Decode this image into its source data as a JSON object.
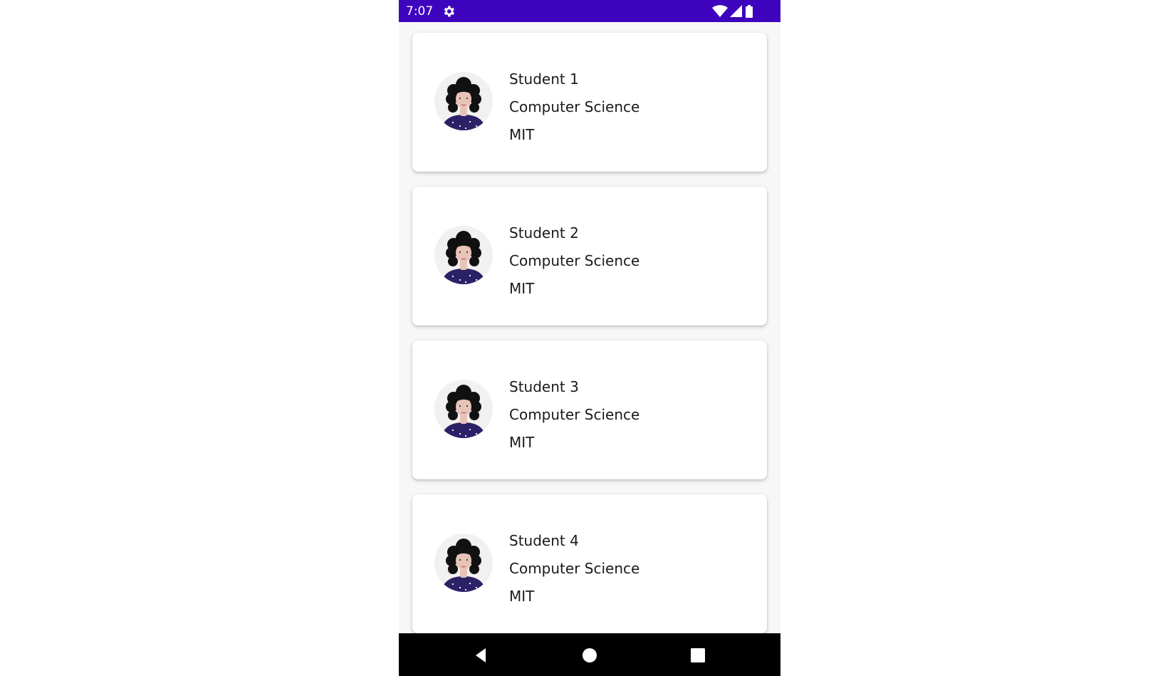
{
  "colors": {
    "accent": "#3e04bd",
    "nav_bar": "#000000",
    "card_background": "#ffffff",
    "avatar_shirt": "#2a2166",
    "avatar_hair": "#111111",
    "avatar_skin": "#e8c3b8"
  },
  "status_bar": {
    "time": "7:07",
    "icons": [
      "settings-icon",
      "wifi-icon",
      "cell-signal-icon",
      "battery-icon"
    ]
  },
  "students": [
    {
      "name": "Student 1",
      "major": "Computer Science",
      "school": "MIT",
      "avatar": "woman-avatar-icon"
    },
    {
      "name": "Student 2",
      "major": "Computer Science",
      "school": "MIT",
      "avatar": "woman-avatar-icon"
    },
    {
      "name": "Student 3",
      "major": "Computer Science",
      "school": "MIT",
      "avatar": "woman-avatar-icon"
    },
    {
      "name": "Student 4",
      "major": "Computer Science",
      "school": "MIT",
      "avatar": "woman-avatar-icon"
    }
  ],
  "nav_bar": {
    "icons": [
      "back-icon",
      "home-icon",
      "recents-icon"
    ]
  }
}
